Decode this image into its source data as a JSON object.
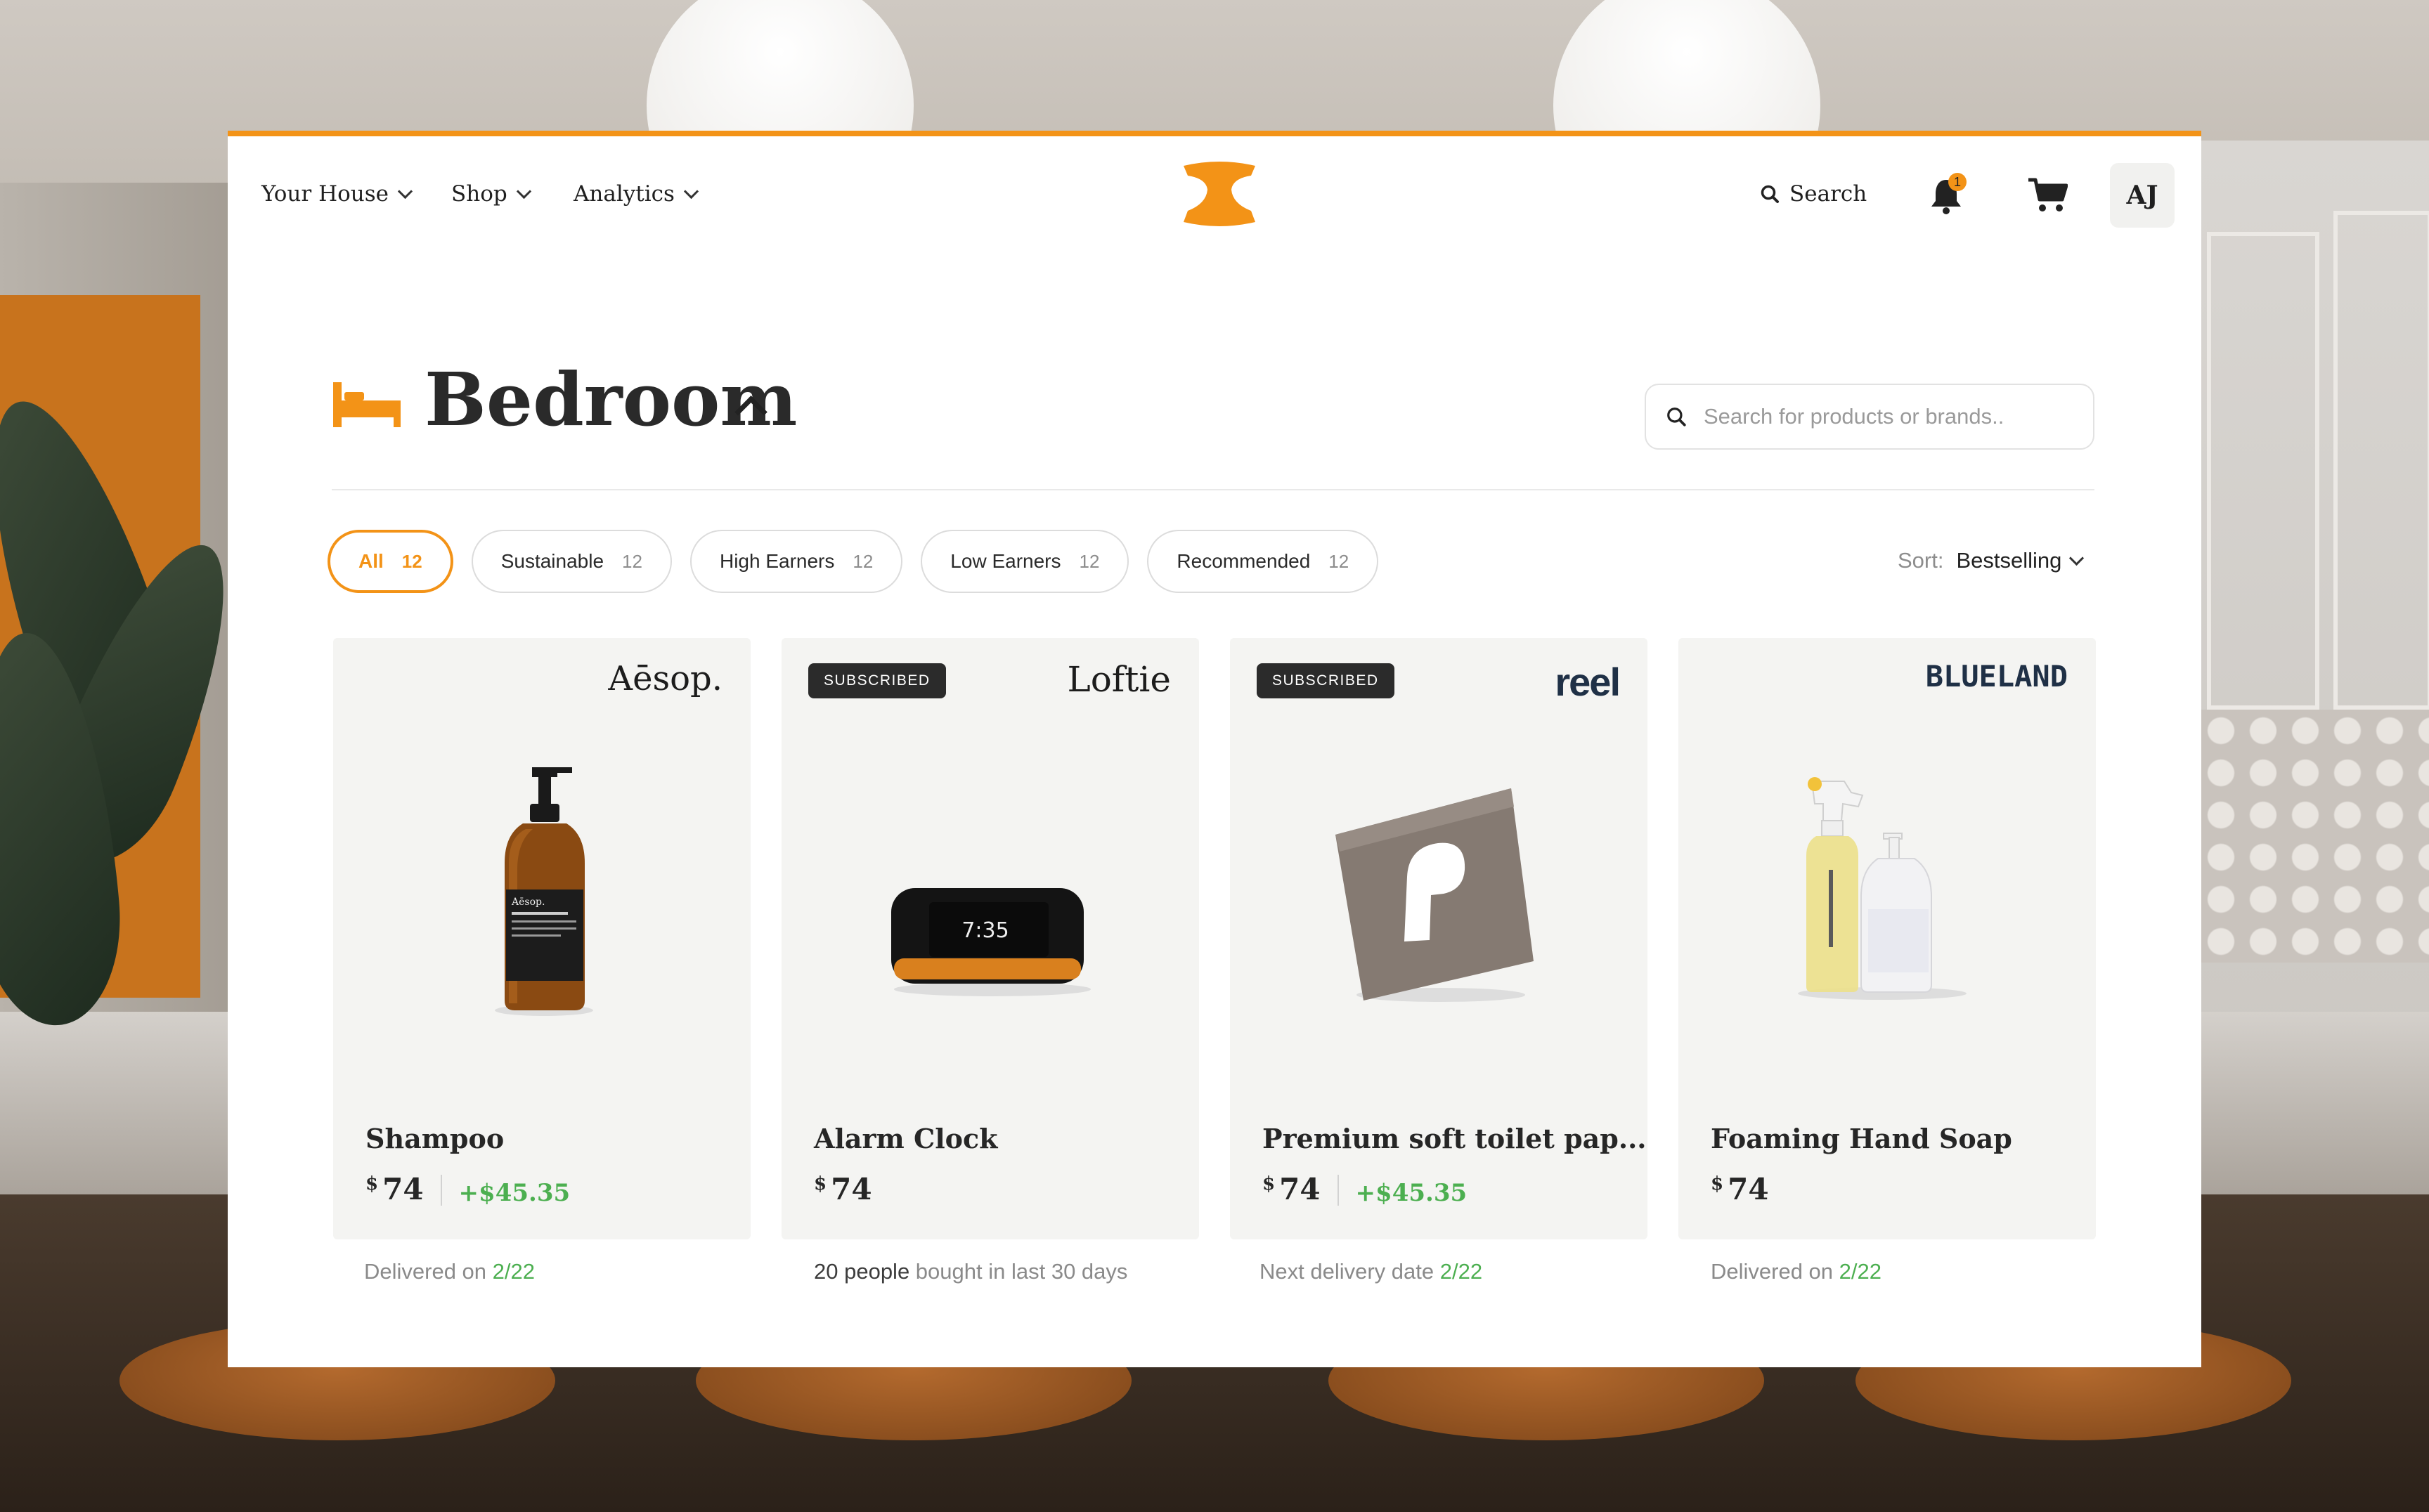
{
  "nav": {
    "items": [
      {
        "label": "Your House"
      },
      {
        "label": "Shop"
      },
      {
        "label": "Analytics"
      }
    ],
    "search_label": "Search",
    "notification_count": "1",
    "avatar_initials": "AJ"
  },
  "room": {
    "title": "Bedroom",
    "search_placeholder": "Search for products or brands.."
  },
  "filters": [
    {
      "label": "All",
      "count": "12",
      "active": true
    },
    {
      "label": "Sustainable",
      "count": "12"
    },
    {
      "label": "High Earners",
      "count": "12"
    },
    {
      "label": "Low Earners",
      "count": "12"
    },
    {
      "label": "Recommended",
      "count": "12"
    }
  ],
  "sort": {
    "label": "Sort:",
    "value": "Bestselling"
  },
  "products": [
    {
      "brand": "Aēsop.",
      "name": "Shampoo",
      "currency": "$",
      "price": "74",
      "gain": "+$45.35",
      "note_prefix": "Delivered on ",
      "note_highlight": "2/22"
    },
    {
      "badge": "SUBSCRIBED",
      "brand": "Loftie",
      "name": "Alarm Clock",
      "currency": "$",
      "price": "74",
      "clock_time": "7:35",
      "note_dark": "20 people",
      "note_suffix": " bought in last 30 days"
    },
    {
      "badge": "SUBSCRIBED",
      "brand": "reel",
      "name": "Premium soft toilet pap...",
      "currency": "$",
      "price": "74",
      "gain": "+$45.35",
      "note_prefix": "Next delivery date ",
      "note_highlight": "2/22"
    },
    {
      "brand": "BLUELAND",
      "name": "Foaming Hand Soap",
      "currency": "$",
      "price": "74",
      "note_prefix": "Delivered on ",
      "note_highlight": "2/22"
    }
  ],
  "colors": {
    "accent": "#f39317",
    "gain_green": "#4caf50",
    "card_bg": "#f4f4f2",
    "badge_bg": "#2b2b2b"
  },
  "icons": [
    "chevron-down-icon",
    "logo-icon",
    "search-icon",
    "bell-icon",
    "cart-icon",
    "bed-icon",
    "chevron-up-icon"
  ]
}
